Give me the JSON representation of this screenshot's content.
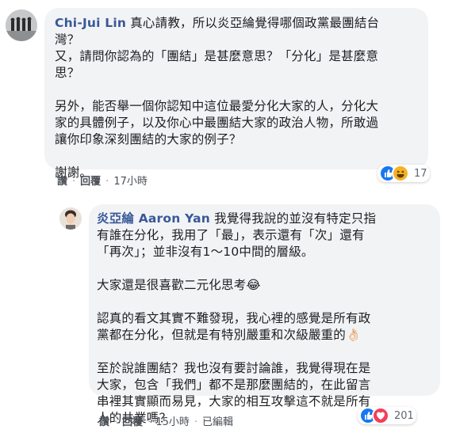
{
  "comment1": {
    "author": "Chi-Jui Lin",
    "lines": [
      "真心請教，所以炎亞綸覺得哪個政黨最團結台",
      "灣？",
      "又，請問你認為的「團結」是甚麼意思？「分化」是甚麼意",
      "思？",
      "",
      "另外，能否舉一個你認知中這位最愛分化大家的人，分化大",
      "家的具體例子，以及你心中最團結大家的政治人物，所敢過",
      "讓你印象深刻團結的大家的例子？",
      "",
      "謝謝。"
    ],
    "first_line_text": "真心請教，所以炎亞綸覺得哪個政黨最團結台",
    "actions": {
      "like": "讚",
      "reply": "回覆",
      "time": "17小時"
    },
    "reaction_count": "17"
  },
  "comment2": {
    "author": "炎亞綸 Aaron Yan",
    "first_line_text": "我覺得我說的並沒有特定只指",
    "lines": [
      "有誰在分化，我用了「最」，表示還有「次」還有",
      "「再次」；並非沒有1～10中間的層級。",
      "",
      "大家還是很喜歡二元化思考😂",
      "",
      "認真的看文其實不難發現，我心裡的感覺是所有政",
      "黨都在分化，但就是有特別嚴重和次級嚴重的👌🏻",
      "",
      "至於說誰團結？我也沒有要討論誰，我覺得現在是",
      "大家，包含「我們」都不是那麼團結的，在此留言",
      "串裡其實顯而易見，大家的相互攻擊這不就是所有",
      "人的共業嗎？"
    ],
    "actions": {
      "like": "讚",
      "reply": "回覆",
      "time": "15小時",
      "edited": "已編輯"
    },
    "reaction_count": "201"
  },
  "icons": [
    "avatar-cartoon-icon",
    "avatar-photo-icon",
    "like-icon",
    "haha-icon",
    "love-icon"
  ],
  "colors": {
    "name": "#385898",
    "bubble": "#f2f3f5",
    "like": "#1877f2",
    "haha": "#f7b125",
    "love": "#f33e58"
  }
}
